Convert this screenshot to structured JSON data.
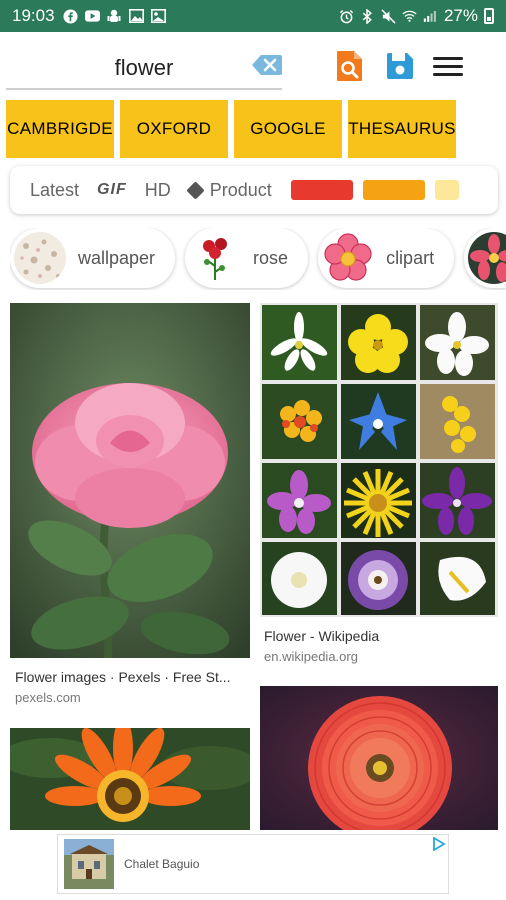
{
  "status_bar": {
    "time": "19:03",
    "battery_percent": "27%",
    "left_icons": [
      "facebook-icon",
      "youtube-icon",
      "usb-debug-icon",
      "image-icon",
      "photo-icon"
    ],
    "right_icons": [
      "alarm-icon",
      "bluetooth-icon",
      "mute-icon",
      "wifi-icon",
      "signal-icon",
      "battery-icon"
    ]
  },
  "search": {
    "query": "flower"
  },
  "dictionaries": [
    "CAMBRIGDE",
    "OXFORD",
    "GOOGLE",
    "THESAURUS"
  ],
  "filters": {
    "latest": "Latest",
    "gif": "GIF",
    "hd": "HD",
    "product": "Product",
    "color_swatches": [
      "#e8392e",
      "#f5a312",
      "#fde79a"
    ]
  },
  "suggestions": [
    {
      "label": "wallpaper"
    },
    {
      "label": "rose"
    },
    {
      "label": "clipart"
    },
    {
      "label": ""
    }
  ],
  "results": [
    {
      "title": "Flower images · Pexels · Free St...",
      "source": "pexels.com"
    },
    {
      "title": "Flower - Wikipedia",
      "source": "en.wikipedia.org"
    },
    {
      "title": "",
      "source": ""
    },
    {
      "title": "",
      "source": ""
    }
  ],
  "ad": {
    "text": "Chalet Baguio"
  },
  "colors": {
    "status_bar": "#2b7a5a",
    "dictionary_button": "#f7c31a",
    "search_app_icon": "#f07a1c",
    "save_icon": "#2e9ad6",
    "clear_icon": "#7ab8e0"
  }
}
